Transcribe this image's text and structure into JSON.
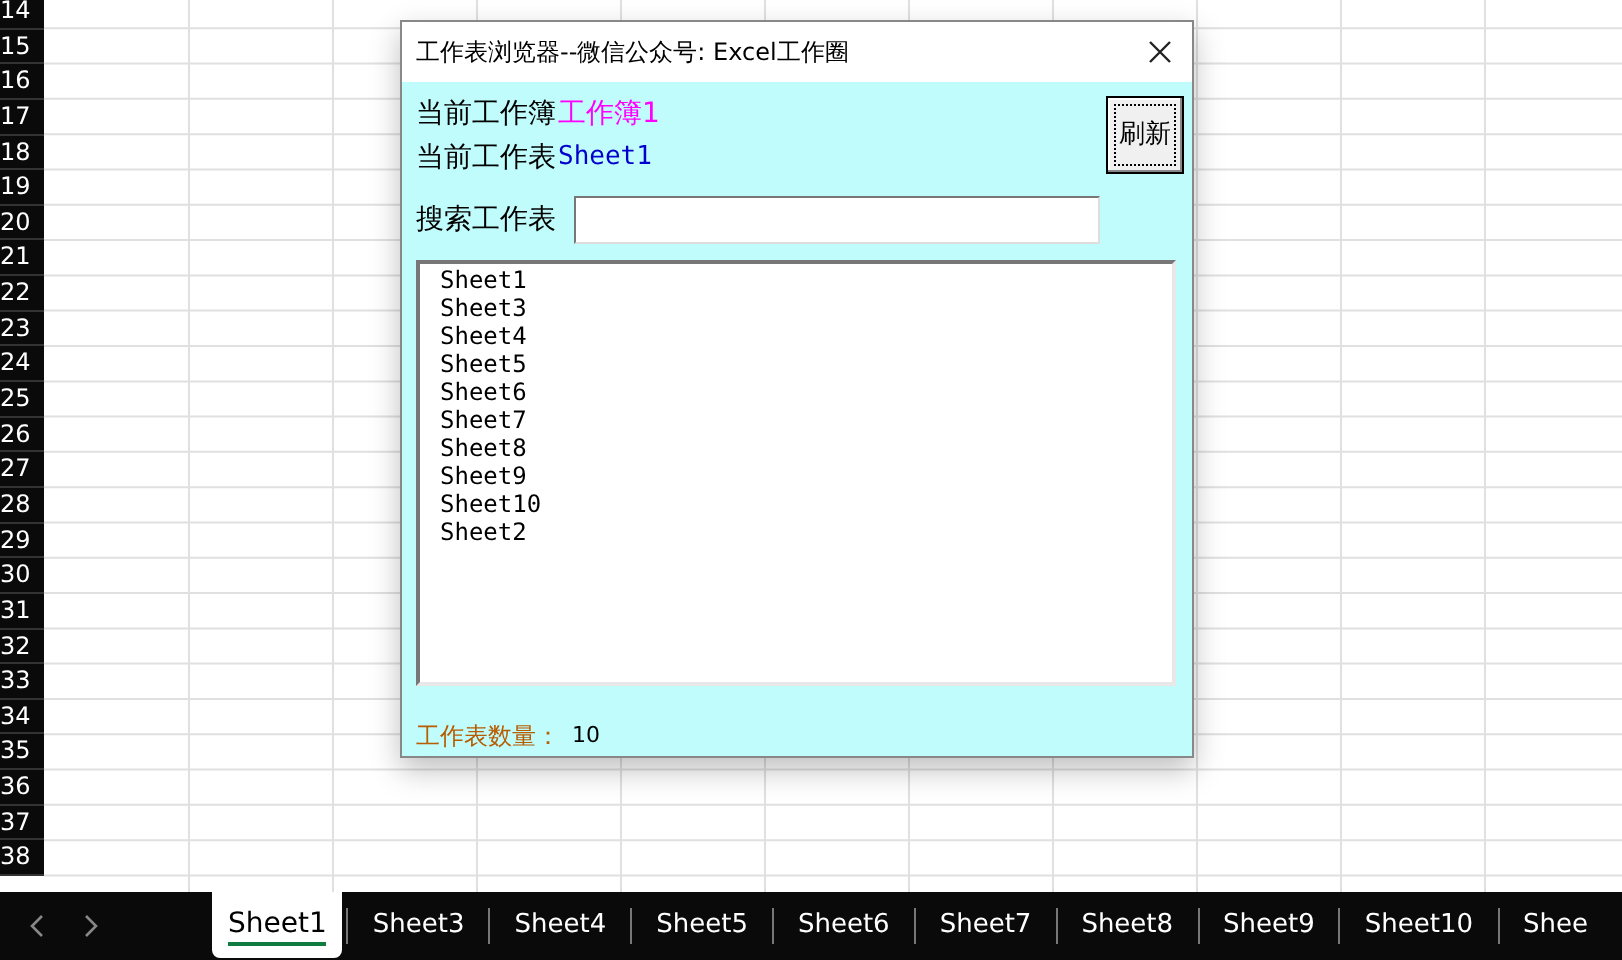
{
  "sheet": {
    "row_headers": [
      "14",
      "15",
      "16",
      "17",
      "18",
      "19",
      "20",
      "21",
      "22",
      "23",
      "24",
      "25",
      "26",
      "27",
      "28",
      "29",
      "30",
      "31",
      "32",
      "33",
      "34",
      "35",
      "36",
      "37",
      "38"
    ]
  },
  "dialog": {
    "title": "工作表浏览器--微信公众号: Excel工作圈",
    "workbook_label": "当前工作簿",
    "workbook_value": "工作簿1",
    "sheet_label": "当前工作表",
    "sheet_value": "Sheet1",
    "refresh_button": "刷新",
    "search_label": "搜索工作表",
    "list_items": [
      "Sheet1",
      "Sheet3",
      "Sheet4",
      "Sheet5",
      "Sheet6",
      "Sheet7",
      "Sheet8",
      "Sheet9",
      "Sheet10",
      "Sheet2"
    ],
    "count_label": "工作表数量：",
    "count_value": "10"
  },
  "sheet_tabs": [
    {
      "label": "Sheet1",
      "selected": true
    },
    {
      "label": "Sheet3",
      "selected": false
    },
    {
      "label": "Sheet4",
      "selected": false
    },
    {
      "label": "Sheet5",
      "selected": false
    },
    {
      "label": "Sheet6",
      "selected": false
    },
    {
      "label": "Sheet7",
      "selected": false
    },
    {
      "label": "Sheet8",
      "selected": false
    },
    {
      "label": "Sheet9",
      "selected": false
    },
    {
      "label": "Sheet10",
      "selected": false
    },
    {
      "label": "Shee",
      "selected": false
    }
  ]
}
